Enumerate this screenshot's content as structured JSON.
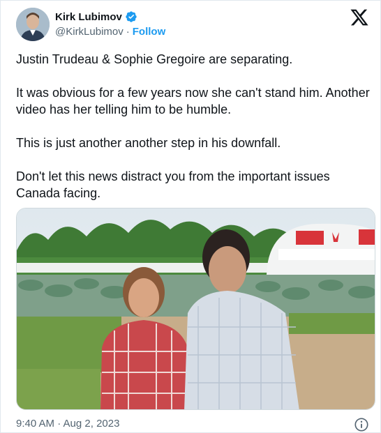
{
  "author": {
    "name": "Kirk Lubimov",
    "handle": "@KirkLubimov",
    "separator": "·",
    "follow_label": "Follow"
  },
  "tweet": {
    "paragraphs": [
      "Justin Trudeau & Sophie Gregoire are separating.",
      "It was obvious for a few years now she can't stand him. Another video has her telling him to be humble.",
      "This is just another another step in his downfall.",
      "Don't let this news distract you from the important issues Canada facing."
    ],
    "timestamp": "9:40 AM · Aug 2, 2023"
  },
  "icons": {
    "verified": "verified-badge-icon",
    "platform": "x-logo-icon",
    "info": "info-icon"
  },
  "colors": {
    "accent": "#1d9bf0",
    "text": "#0f1419",
    "muted": "#536471"
  }
}
